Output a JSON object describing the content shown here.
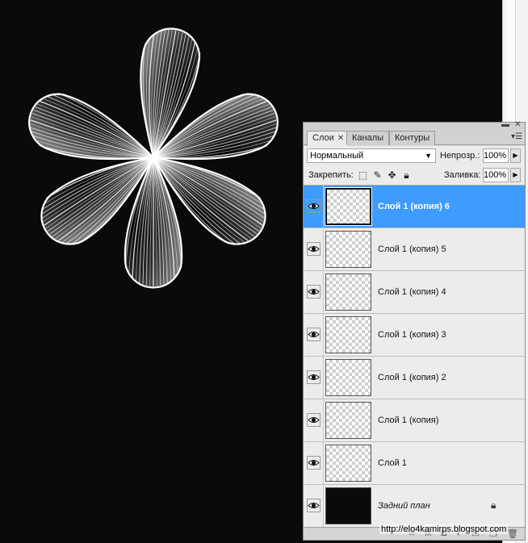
{
  "tabs": [
    {
      "label": "Слои",
      "active": true
    },
    {
      "label": "Каналы",
      "active": false
    },
    {
      "label": "Контуры",
      "active": false
    }
  ],
  "blend_mode": "Нормальный",
  "opacity_label": "Непрозр.:",
  "opacity_value": "100%",
  "lock_label": "Закрепить:",
  "fill_label": "Заливка:",
  "fill_value": "100%",
  "layers": [
    {
      "name": "Слой 1 (копия) 6",
      "selected": true,
      "visible": true
    },
    {
      "name": "Слой 1 (копия) 5",
      "selected": false,
      "visible": true
    },
    {
      "name": "Слой 1 (копия) 4",
      "selected": false,
      "visible": true
    },
    {
      "name": "Слой 1 (копия) 3",
      "selected": false,
      "visible": true
    },
    {
      "name": "Слой 1 (копия) 2",
      "selected": false,
      "visible": true
    },
    {
      "name": "Слой 1 (копия)",
      "selected": false,
      "visible": true
    },
    {
      "name": "Слой 1",
      "selected": false,
      "visible": true
    },
    {
      "name": "Задний план",
      "selected": false,
      "visible": true,
      "background": true,
      "locked": true
    }
  ],
  "watermark": "http://elo4kamirps.blogspot.com",
  "colors": {
    "selection": "#3e9bff",
    "canvas": "#0a0a0a"
  }
}
